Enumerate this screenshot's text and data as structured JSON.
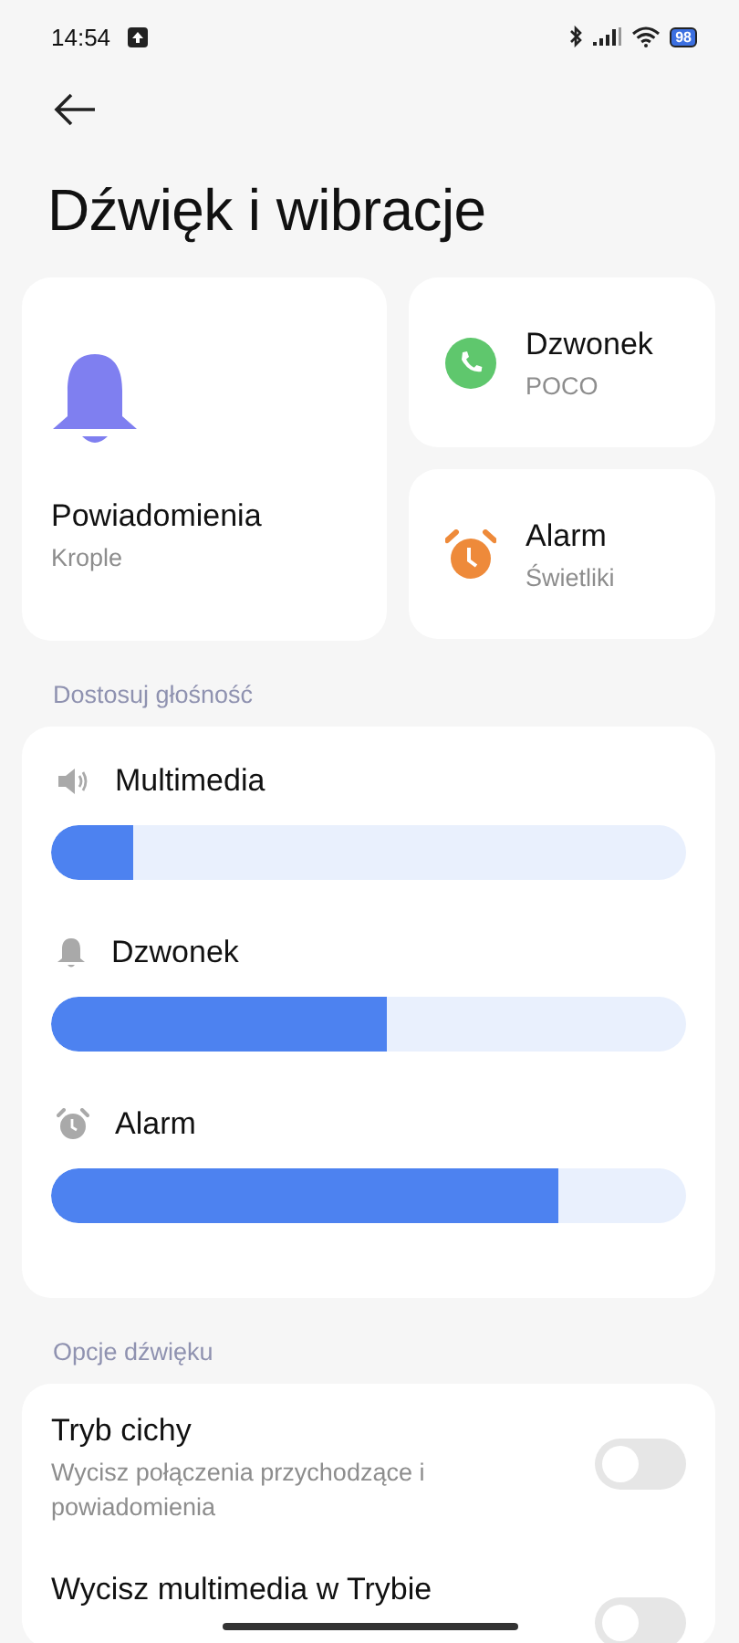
{
  "status_bar": {
    "time": "14:54",
    "battery": "98"
  },
  "title": "Dźwięk i wibracje",
  "sound_cards": [
    {
      "kind": "notification",
      "title": "Powiadomienia",
      "subtitle": "Krople"
    },
    {
      "kind": "ringtone",
      "title": "Dzwonek",
      "subtitle": "POCO"
    },
    {
      "kind": "alarm",
      "title": "Alarm",
      "subtitle": "Świetliki"
    }
  ],
  "volume_section": {
    "label": "Dostosuj głośność",
    "sliders": [
      {
        "kind": "media",
        "label": "Multimedia",
        "level": 0.13
      },
      {
        "kind": "ring",
        "label": "Dzwonek",
        "level": 0.53
      },
      {
        "kind": "alarm",
        "label": "Alarm",
        "level": 0.8
      }
    ]
  },
  "options_section": {
    "label": "Opcje dźwięku",
    "items": [
      {
        "title": "Tryb cichy",
        "description": "Wycisz połączenia przychodzące i powiadomienia",
        "on": false
      },
      {
        "title": "Wycisz multimedia w Trybie",
        "on": false
      }
    ]
  }
}
